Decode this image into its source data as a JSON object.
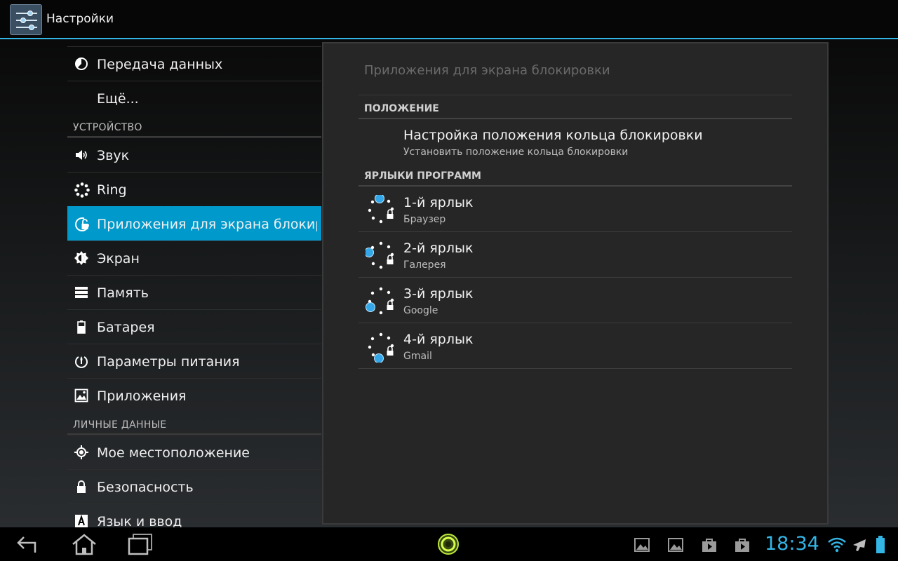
{
  "action_bar": {
    "title": "Настройки",
    "app_icon": "settings-sliders-icon"
  },
  "left_list": [
    {
      "kind": "item",
      "label": "Передача данных",
      "icon": "data-usage-icon",
      "name": "sidebar-item-data-usage"
    },
    {
      "kind": "item",
      "label": "Ещё...",
      "icon": "",
      "name": "sidebar-item-more"
    },
    {
      "kind": "header",
      "label": "УСТРОЙСТВО",
      "name": "section-header-device"
    },
    {
      "kind": "item",
      "label": "Звук",
      "icon": "volume-icon",
      "name": "sidebar-item-sound"
    },
    {
      "kind": "item",
      "label": "Ring",
      "icon": "ring-icon",
      "name": "sidebar-item-ring"
    },
    {
      "kind": "item",
      "label": "Приложения для экрана блокировки",
      "icon": "lockscreen-apps-icon",
      "name": "sidebar-item-lockscreen-apps",
      "selected": true
    },
    {
      "kind": "item",
      "label": "Экран",
      "icon": "brightness-icon",
      "name": "sidebar-item-display"
    },
    {
      "kind": "item",
      "label": "Память",
      "icon": "storage-icon",
      "name": "sidebar-item-storage"
    },
    {
      "kind": "item",
      "label": "Батарея",
      "icon": "battery-icon",
      "name": "sidebar-item-battery"
    },
    {
      "kind": "item",
      "label": "Параметры питания",
      "icon": "power-icon",
      "name": "sidebar-item-power"
    },
    {
      "kind": "item",
      "label": "Приложения",
      "icon": "apps-icon",
      "name": "sidebar-item-apps"
    },
    {
      "kind": "header",
      "label": "ЛИЧНЫЕ ДАННЫЕ",
      "name": "section-header-personal"
    },
    {
      "kind": "item",
      "label": "Мое местоположение",
      "icon": "location-icon",
      "name": "sidebar-item-location"
    },
    {
      "kind": "item",
      "label": "Безопасность",
      "icon": "lock-icon",
      "name": "sidebar-item-security"
    },
    {
      "kind": "item",
      "label": "Язык и ввод",
      "icon": "language-icon",
      "name": "sidebar-item-language"
    }
  ],
  "detail": {
    "title": "Приложения для экрана блокировки",
    "position_header": "ПОЛОЖЕНИЕ",
    "position_pref": {
      "title": "Настройка положения кольца блокировки",
      "summary": "Установить положение кольца блокировки"
    },
    "shortcuts_header": "ЯРЛЫКИ ПРОГРАММ",
    "shortcuts": [
      {
        "title": "1-й ярлык",
        "summary": "Браузер",
        "icon": "lock-ring-shortcut-1-icon"
      },
      {
        "title": "2-й ярлык",
        "summary": "Галерея",
        "icon": "lock-ring-shortcut-2-icon"
      },
      {
        "title": "3-й ярлык",
        "summary": "Google",
        "icon": "lock-ring-shortcut-3-icon"
      },
      {
        "title": "4-й ярлык",
        "summary": "Gmail",
        "icon": "lock-ring-shortcut-4-icon"
      }
    ]
  },
  "nav_bar": {
    "clock": "18:34",
    "buttons": [
      "back-icon",
      "home-icon",
      "recent-apps-icon"
    ],
    "center_icon": "lockscreen-ring-icon",
    "status_icons": [
      "gallery-notification-icon",
      "gallery-notification-icon",
      "play-store-notification-icon",
      "play-store-notification-icon",
      "wifi-icon",
      "airplane-mode-icon",
      "battery-status-icon"
    ]
  },
  "colors": {
    "accent": "#33b5e5",
    "selected_bg": "#0099cc",
    "ring_dot": "#33a7e8"
  }
}
